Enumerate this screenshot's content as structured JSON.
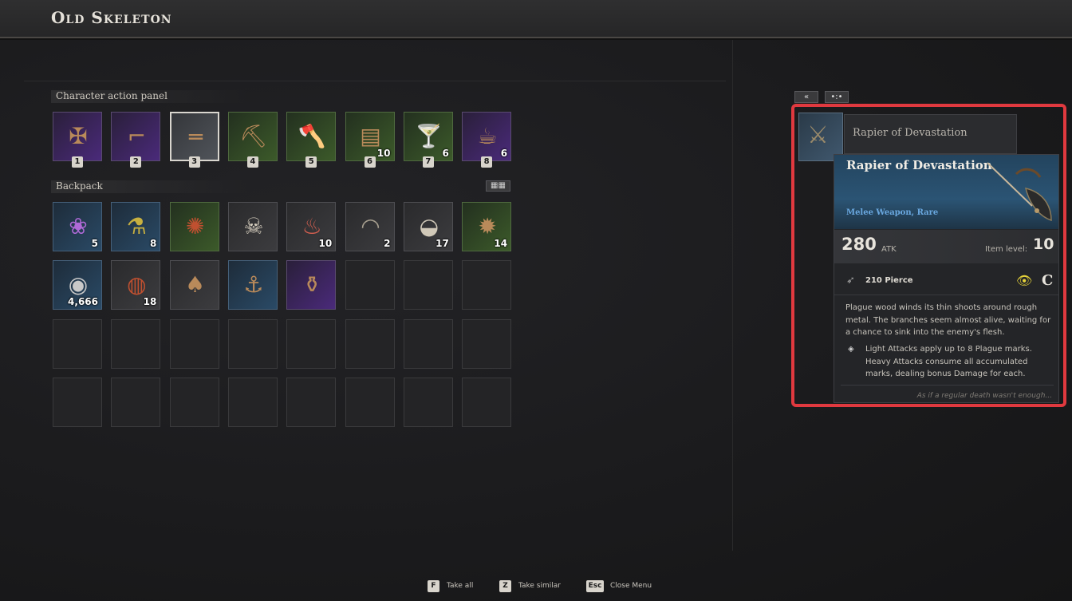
{
  "window": {
    "title": "Old Skeleton"
  },
  "action_panel": {
    "label": "Character action panel",
    "slots": [
      {
        "key": "1",
        "icon": "crossbow-icon",
        "rarity": "purple",
        "count": ""
      },
      {
        "key": "2",
        "icon": "flintlock-pistol-icon",
        "rarity": "purple",
        "count": ""
      },
      {
        "key": "3",
        "icon": "musket-icon",
        "rarity": "selected",
        "count": ""
      },
      {
        "key": "4",
        "icon": "pickaxe-icon",
        "rarity": "green",
        "count": ""
      },
      {
        "key": "5",
        "icon": "axe-icon",
        "rarity": "green",
        "count": ""
      },
      {
        "key": "6",
        "icon": "bandage-icon",
        "rarity": "green",
        "count": "10"
      },
      {
        "key": "7",
        "icon": "lime-drink-icon",
        "rarity": "green",
        "count": "6"
      },
      {
        "key": "8",
        "icon": "coffee-pot-icon",
        "rarity": "purple",
        "count": "6"
      }
    ]
  },
  "backpack": {
    "label": "Backpack",
    "toggle_icon": "grid-view-icon",
    "slots": [
      {
        "icon": "purple-berries-icon",
        "rarity": "blue",
        "count": "5"
      },
      {
        "icon": "potion-vial-icon",
        "rarity": "blue",
        "count": "8"
      },
      {
        "icon": "red-fan-icon",
        "rarity": "green",
        "count": ""
      },
      {
        "icon": "skull-ring-icon",
        "rarity": "grey",
        "count": ""
      },
      {
        "icon": "raw-meat-icon",
        "rarity": "grey",
        "count": "10"
      },
      {
        "icon": "canoe-icon",
        "rarity": "grey",
        "count": "2"
      },
      {
        "icon": "salt-bowl-icon",
        "rarity": "grey",
        "count": "17"
      },
      {
        "icon": "spiked-necklace-icon",
        "rarity": "green",
        "count": "14"
      },
      {
        "icon": "silver-coin-icon",
        "rarity": "blue",
        "count": "4,666"
      },
      {
        "icon": "spice-plate-icon",
        "rarity": "grey",
        "count": "18"
      },
      {
        "icon": "shovel-icon",
        "rarity": "grey",
        "count": ""
      },
      {
        "icon": "grappling-hook-icon",
        "rarity": "blue",
        "count": ""
      },
      {
        "icon": "crab-trap-icon",
        "rarity": "purple",
        "count": ""
      }
    ],
    "total_slots": 32
  },
  "loot_panel": {
    "collapse_label": "«",
    "sort_label": "•:•",
    "behind_card_name": "Rapier of Devastation",
    "item_icon": "rapier-icon"
  },
  "tooltip": {
    "name": "Rapier of Devastation",
    "type": "Melee Weapon, Rare",
    "atk_value": "280",
    "atk_unit": "ATK",
    "item_level_label": "Item level:",
    "item_level": "10",
    "damage_type": "210 Pierce",
    "grade": "C",
    "description": "Plague wood winds its thin shoots around rough metal. The branches seem almost alive, waiting for a chance to sink into the enemy's flesh.",
    "perk": "Light Attacks apply up to 8 Plague marks. Heavy Attacks consume all accumulated marks, dealing bonus Damage for each.",
    "flavor": "As if a regular death wasn't enough..."
  },
  "footer": [
    {
      "key": "F",
      "label": "Take all"
    },
    {
      "key": "Z",
      "label": "Take similar"
    },
    {
      "key": "Esc",
      "label": "Close Menu"
    }
  ],
  "colors": {
    "highlight": "#e0393f",
    "rare_blue": "#6aa8e0",
    "eye_yellow": "#e5d23a"
  }
}
